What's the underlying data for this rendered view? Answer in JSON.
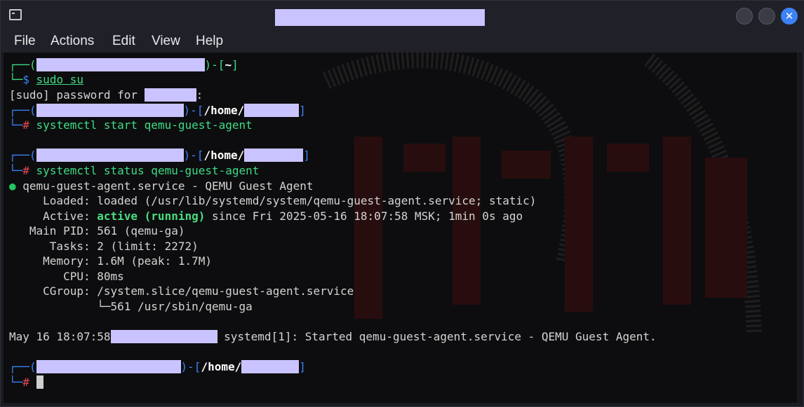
{
  "window": {
    "title": ""
  },
  "menu": {
    "file": "File",
    "actions": "Actions",
    "edit": "Edit",
    "view": "View",
    "help": "Help"
  },
  "terminal": {
    "home_prompt": {
      "tilde": "~"
    },
    "cmd1": {
      "sym": "$",
      "text": "sudo su"
    },
    "sudo_prompt": {
      "before": "[sudo] password for ",
      "after": ":"
    },
    "root_prompt": {
      "path": "/home/"
    },
    "cmd2": {
      "sym": "#",
      "text": "systemctl start qemu-guest-agent"
    },
    "cmd3": {
      "sym": "#",
      "text": "systemctl status qemu-guest-agent"
    },
    "status": {
      "bullet": "●",
      "header": "qemu-guest-agent.service - QEMU Guest Agent",
      "loaded_label": "     Loaded: ",
      "loaded_value": "loaded (/usr/lib/systemd/system/qemu-guest-agent.service; static)",
      "active_label": "     Active: ",
      "active_state": "active (running)",
      "active_rest": " since Fri 2025-05-16 18:07:58 MSK; 1min 0s ago",
      "pid_label": "   Main PID: ",
      "pid_value": "561 (qemu-ga)",
      "tasks_label": "      Tasks: ",
      "tasks_value": "2 (limit: 2272)",
      "memory_label": "     Memory: ",
      "memory_value": "1.6M (peak: 1.7M)",
      "cpu_label": "        CPU: ",
      "cpu_value": "80ms",
      "cgroup_label": "     CGroup: ",
      "cgroup_value": "/system.slice/qemu-guest-agent.service",
      "cgroup_child": "             └─561 /usr/sbin/qemu-ga"
    },
    "log": {
      "time": "May 16 18:07:58",
      "message": " systemd[1]: Started qemu-guest-agent.service - QEMU Guest Agent."
    },
    "final_prompt": {
      "sym": "#"
    }
  },
  "colors": {
    "prompt_green": "#3ddc84",
    "prompt_blue": "#3b82f6",
    "root_red": "#e5484d",
    "accent": "#3b82f6"
  }
}
